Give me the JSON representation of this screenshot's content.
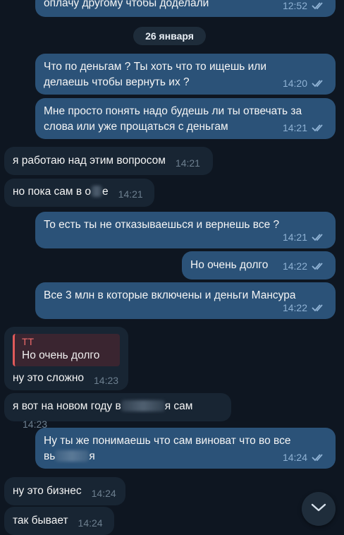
{
  "messages": [
    {
      "text": "оплачу другому чтобы доделали",
      "time": "12:52"
    },
    {
      "text": "Что по деньгам ? Ты хоть что то ищешь или делаешь чтобы вернуть их ?",
      "time": "14:20"
    },
    {
      "text": "Мне просто понять надо будешь ли ты отвечать за слова или уже прощаться с деньгам",
      "time": "14:21"
    },
    {
      "text": "я работаю над этим вопросом",
      "time": "14:21"
    },
    {
      "text_before": "но пока сам в о",
      "text_after": "е",
      "time": "14:21"
    },
    {
      "text": "То есть ты не отказываешься и вернешь все ?",
      "time": "14:21"
    },
    {
      "text": "Но очень долго",
      "time": "14:22"
    },
    {
      "text": "Все 3 млн в которые включены и деньги Мансура",
      "time": "14:22"
    },
    {
      "reply_name": "ТТ",
      "reply_text": "Но очень долго",
      "text": "ну это сложно",
      "time": "14:23"
    },
    {
      "text_before": "я вот на новом году в",
      "text_after": "я сам",
      "time": "14:23"
    },
    {
      "text": "Ну ты же понимаешь что сам виноват что во все",
      "text_line2_before": "вь",
      "text_line2_after": "я",
      "time": "14:24"
    },
    {
      "text": "ну это бизнес",
      "time": "14:24"
    },
    {
      "text": "так бывает",
      "time": "14:24"
    }
  ],
  "date_separator": "26 января",
  "icons": {
    "read": "double-check-icon",
    "scroll": "chevron-down-icon"
  },
  "colors": {
    "outgoing": "#2b5278",
    "incoming": "#182533",
    "background": "#0e1621"
  }
}
